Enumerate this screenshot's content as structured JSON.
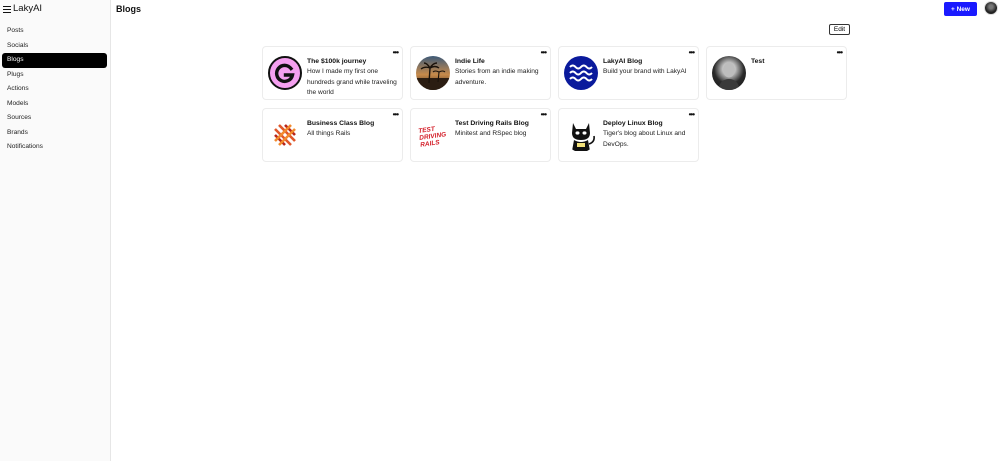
{
  "app": {
    "name": "LakyAI"
  },
  "sidebar": {
    "items": [
      {
        "label": "Posts"
      },
      {
        "label": "Socials"
      },
      {
        "label": "Blogs",
        "active": true
      },
      {
        "label": "Plugs"
      },
      {
        "label": "Actions"
      },
      {
        "label": "Models"
      },
      {
        "label": "Sources"
      },
      {
        "label": "Brands"
      },
      {
        "label": "Notifications"
      }
    ]
  },
  "header": {
    "title": "Blogs",
    "new_label": "+ New",
    "edit_label": "Edit"
  },
  "blogs": [
    {
      "title": "The $100k journey",
      "description": "How I made my first one hundreds grand while traveling the world",
      "icon": "letter-g-logo",
      "menu": "•••"
    },
    {
      "title": "Indie Life",
      "description": "Stories from an indie making adventure.",
      "icon": "palm-sunset-photo",
      "menu": "•••"
    },
    {
      "title": "LakyAI Blog",
      "description": "Build your brand with LakyAI",
      "icon": "waves-logo",
      "menu": "•••"
    },
    {
      "title": "Test",
      "description": "",
      "icon": "person-photo",
      "menu": "•••"
    },
    {
      "title": "Business Class Blog",
      "description": "All things Rails",
      "icon": "rails-stripes-logo",
      "menu": "•••"
    },
    {
      "title": "Test Driving Rails Blog",
      "description": "Minitest and RSpec blog",
      "icon": "test-driving-rails-logo",
      "logo_text": "TEST DRIVING RAILS",
      "menu": "•••"
    },
    {
      "title": "Deploy Linux Blog",
      "description": "Tiger's blog about Linux and DevOps.",
      "icon": "cat-mascot-logo",
      "menu": "•••"
    }
  ],
  "colors": {
    "primary": "#1a1aff",
    "active_nav": "#000000",
    "sidebar_bg": "#fafafa"
  }
}
